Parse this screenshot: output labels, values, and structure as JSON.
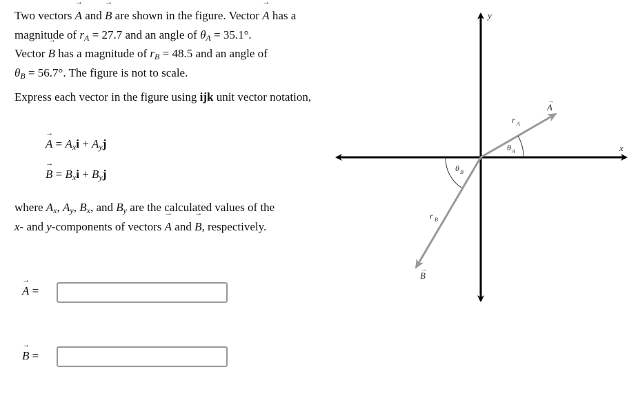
{
  "problem": {
    "intro": {
      "t1": "Two vectors ",
      "vecA": "A",
      "t2": " and ",
      "vecB": "B",
      "t3": " are shown in the figure. Vector ",
      "t4": " has a magnitude of ",
      "rA_sym": "r",
      "rA_sub": "A",
      "eq": " = ",
      "rA_val": "27.7",
      "t5": " and an angle of ",
      "thA_sym": "θ",
      "thA_sub": "A",
      "thA_val": "35.1°.",
      "t6": "Vector ",
      "t7": " has a magnitude of ",
      "rB_sym": "r",
      "rB_sub": "B",
      "rB_val": "48.5",
      "t8": " and an angle of",
      "thB_sym": "θ",
      "thB_sub": "B",
      "thB_val": "56.7°.",
      "t9": " The figure is not to scale."
    },
    "instruction": {
      "t1": "Express each vector in the figure using ",
      "bold": "ijk",
      "t2": " unit vector notation,"
    },
    "equations": {
      "A": {
        "lhs": "A",
        "eq": " = ",
        "c1": "A",
        "s1": "x",
        "u1": "i",
        "plus": " + ",
        "c2": "A",
        "s2": "y",
        "u2": "j"
      },
      "B": {
        "lhs": "B",
        "eq": " = ",
        "c1": "B",
        "s1": "x",
        "u1": "i",
        "plus": " + ",
        "c2": "B",
        "s2": "y",
        "u2": "j"
      }
    },
    "where": {
      "t1": "where ",
      "Ax": "A",
      "Ax_s": "x",
      "comma": ", ",
      "Ay": "A",
      "Ay_s": "y",
      "Bx": "B",
      "Bx_s": "x",
      "and": ", and ",
      "By": "B",
      "By_s": "y",
      "t2": " are the calculated values of the ",
      "x": "x",
      "t3": "- and ",
      "y": "y",
      "t4": "-components of vectors ",
      "vA": "A",
      "t5": " and ",
      "vB": "B",
      "t6": ", respectively."
    }
  },
  "answers": {
    "A": {
      "label": "A",
      "eq": " =",
      "value": "",
      "placeholder": ""
    },
    "B": {
      "label": "B",
      "eq": " =",
      "value": "",
      "placeholder": ""
    }
  },
  "figure": {
    "x_axis_label": "x",
    "y_axis_label": "y",
    "vector_A_label": "A",
    "vector_B_label": "B",
    "rA_label": "r",
    "rA_sub": "A",
    "rB_label": "r",
    "rB_sub": "B",
    "thetaA_label": "θ",
    "thetaA_sub": "A",
    "thetaB_label": "θ",
    "thetaB_sub": "B",
    "vector_color": "#999999",
    "axis_color": "#000000"
  }
}
